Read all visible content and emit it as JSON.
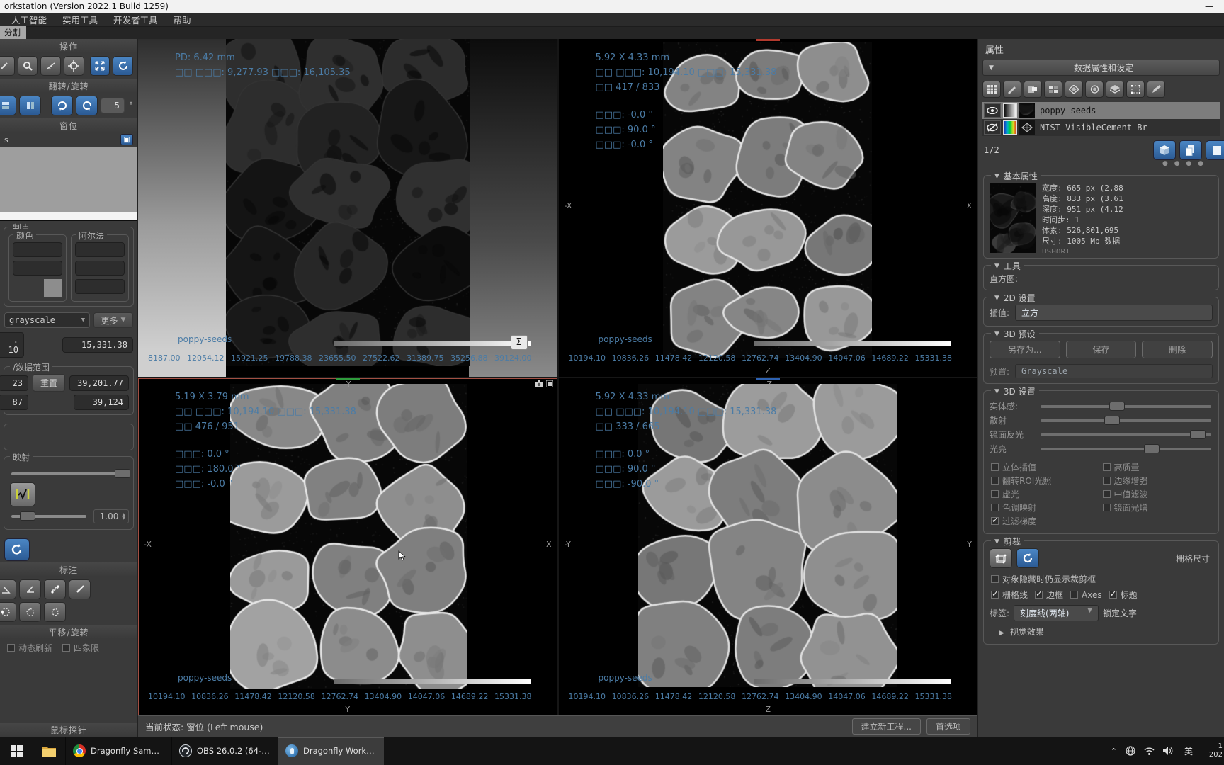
{
  "window": {
    "title": "orkstation (Version 2022.1 Build 1259)",
    "minimize_glyph": "—"
  },
  "menubar": {
    "items": [
      "人工智能",
      "实用工具",
      "开发者工具",
      "帮助"
    ]
  },
  "tabs": {
    "segment": "分割"
  },
  "left_panel": {
    "operate_header": "操作",
    "flip_rotate_header": "翻转/旋转",
    "rotate_step_value": "5",
    "degree_symbol": "°",
    "window_level_header": "窗位",
    "window_level_suffix": "s",
    "control_points_header": "制点",
    "color_group_label": "颜色",
    "alpha_group_label": "阿尔法",
    "lut_selected": "grayscale",
    "more_button": "更多",
    "level_min_value": ". 10",
    "level_max_value": "15,331.38",
    "data_range_header": "/数据范围",
    "reset_button": "重置",
    "range_row1_left": "23",
    "range_row1_right": "39,201.77",
    "range_row2_left": "87",
    "range_row2_right": "39,124",
    "mapping_header": "映射",
    "mapping_slider1": 97,
    "mapping_slider2": 22,
    "gamma_value": "1.00",
    "annotate_header": "标注",
    "pan_rotate_header": "平移/旋转",
    "dynamic_refresh_checkbox": "动态刷新",
    "quadrant_checkbox": "四象限",
    "probe_header": "鼠标探针"
  },
  "viewports": {
    "top_left": {
      "line1": "PD: 6.42 mm",
      "line2": "□□ □□□: 9,277.93 □□□: 16,105.35",
      "dataset_label": "poppy-seeds",
      "sigma_button": "Σ",
      "ticks": [
        "8187.00",
        "12054.12",
        "15921.25",
        "19788.38",
        "23655.50",
        "27522.62",
        "31389.75",
        "35256.88",
        "39124.00"
      ]
    },
    "top_right": {
      "size_line": "5.92 X 4.33 mm",
      "level_line": "□□ □□□: 10,194.10 □□□: 15,331.38",
      "slice_line": "□□ 417 / 833",
      "angle1": "□□□: -0.0 °",
      "angle2": "□□□: 90.0 °",
      "angle3": "□□□: -0.0 °",
      "axis_left": "-X",
      "axis_right": "X",
      "axis_bottom": "Z",
      "slice_tick_color": "#b23a2e",
      "dataset_label": "poppy-seeds",
      "ticks": [
        "10194.10",
        "10836.26",
        "11478.42",
        "12120.58",
        "12762.74",
        "13404.90",
        "14047.06",
        "14689.22",
        "15331.38"
      ]
    },
    "bottom_left": {
      "size_line": "5.19 X 3.79 mm",
      "level_line": "□□ □□□: 10,194.10 □□□: 15,331.38",
      "slice_line": "□□ 476 / 951",
      "angle1": "□□□: 0.0 °",
      "angle2": "□□□: 180.0 °",
      "angle3": "□□□: -0.0 °",
      "axis_top": "-Y",
      "axis_left": "-X",
      "axis_right": "X",
      "axis_bottom": "Y",
      "slice_tick_color": "#2e9b3c",
      "dataset_label": "poppy-seeds",
      "ticks": [
        "10194.10",
        "10836.26",
        "11478.42",
        "12120.58",
        "12762.74",
        "13404.90",
        "14047.06",
        "14689.22",
        "15331.38"
      ]
    },
    "bottom_right": {
      "size_line": "5.92 X 4.33 mm",
      "level_line": "□□ □□□: 10,194.10 □□□: 15,331.38",
      "slice_line": "□□ 333 / 665",
      "angle1": "□□□: 0.0 °",
      "angle2": "□□□: 90.0 °",
      "angle3": "□□□: -90.0 °",
      "axis_top": "-Z",
      "axis_left": "-Y",
      "axis_right": "Y",
      "axis_bottom": "Z",
      "slice_tick_color": "#2e62b2",
      "dataset_label": "poppy-seeds",
      "ticks": [
        "10194.10",
        "10836.26",
        "11478.42",
        "12120.58",
        "12762.74",
        "13404.90",
        "14047.06",
        "14689.22",
        "15331.38"
      ]
    }
  },
  "status_bar": {
    "state_text": "当前状态: 窗位 (Left mouse)",
    "new_project_button": "建立新工程...",
    "preferences_button": "首选项"
  },
  "right_panel": {
    "title": "属性",
    "settings_header": "数据属性和设定",
    "dataset1_name": "poppy-seeds",
    "dataset2_name": "NIST VisibleCement Br",
    "page_indicator": "1/2",
    "dots": "● ● ● ●",
    "basic_props_header": "基本属性",
    "props": {
      "width": "宽度: 665 px (2.88",
      "height": "高度: 833 px (3.61",
      "depth": "深度: 951 px (4.12",
      "timestep": "时间步: 1",
      "voxels": "体素: 526,801,695",
      "size": "尺寸: 1005 Mb  数据",
      "dtype": "USHORT"
    },
    "tools_header": "工具",
    "histogram_label": "直方图:",
    "settings2d_header": "2D 设置",
    "interpolation_label": "插值:",
    "interpolation_value": "立方",
    "presets3d_header": "3D 预设",
    "save_as_button": "另存为...",
    "save_button": "保存",
    "delete_button": "删除",
    "preset_label": "预置:",
    "preset_value": "Grayscale",
    "settings3d_header": "3D 设置",
    "sliders": [
      {
        "label": "实体感:",
        "value": 45
      },
      {
        "label": "散射",
        "value": 42
      },
      {
        "label": "镜面反光",
        "value": 92
      },
      {
        "label": "光亮",
        "value": 65
      }
    ],
    "checkboxes": [
      {
        "label": "立体插值",
        "checked": false
      },
      {
        "label": "高质量",
        "checked": false
      },
      {
        "label": "翻转ROI光照",
        "checked": false
      },
      {
        "label": "边缘增强",
        "checked": false
      },
      {
        "label": "虚光",
        "checked": false
      },
      {
        "label": "中值滤波",
        "checked": false
      },
      {
        "label": "色调映射",
        "checked": false
      },
      {
        "label": "镜面光增",
        "checked": false
      },
      {
        "label": "过滤梯度",
        "checked": true
      }
    ],
    "crop_header": "剪裁",
    "grid_size_label": "栅格尺寸",
    "crop_checkbox": {
      "label": "对象隐藏时仍显示裁剪框",
      "checked": false
    },
    "crop_row": [
      {
        "label": "栅格线",
        "checked": true
      },
      {
        "label": "边框",
        "checked": true
      },
      {
        "label": "Axes",
        "checked": false
      },
      {
        "label": "标题",
        "checked": true
      }
    ],
    "label_row_label": "标签:",
    "label_row_value": "刻度线(两轴)",
    "label_row_suffix": "锁定文字",
    "visual_effects": "视觉效果"
  },
  "taskbar": {
    "apps": [
      {
        "label": "Dragonfly Sampl..."
      },
      {
        "label": "OBS 26.0.2 (64-bi..."
      },
      {
        "label": "Dragonfly Workst..."
      }
    ],
    "lang": "英",
    "clock_line1": "1",
    "clock_line2": "202"
  }
}
